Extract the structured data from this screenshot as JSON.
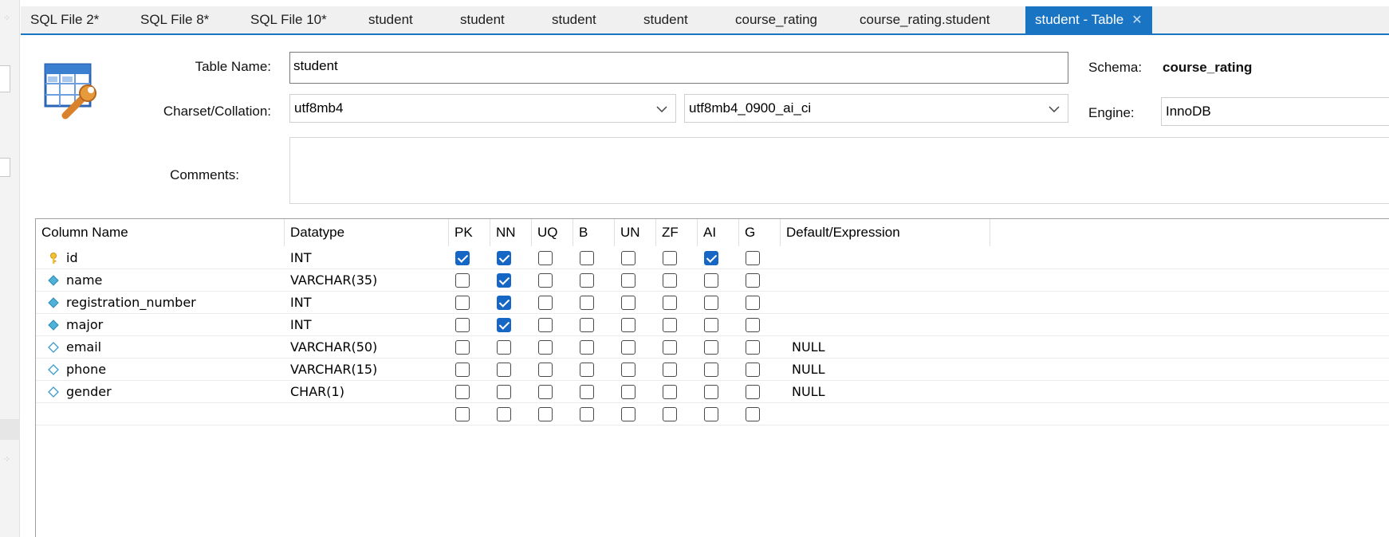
{
  "tabs": [
    {
      "label": "SQL File 2*"
    },
    {
      "label": "SQL File 8*"
    },
    {
      "label": "SQL File 10*"
    },
    {
      "label": "student"
    },
    {
      "label": "student"
    },
    {
      "label": "student"
    },
    {
      "label": "student"
    },
    {
      "label": "course_rating"
    },
    {
      "label": "course_rating.student"
    },
    {
      "label": "student - Table",
      "active": true
    }
  ],
  "form": {
    "table_name_label": "Table Name:",
    "table_name_value": "student",
    "schema_label": "Schema:",
    "schema_value": "course_rating",
    "charset_label": "Charset/Collation:",
    "charset_value": "utf8mb4",
    "collation_value": "utf8mb4_0900_ai_ci",
    "engine_label": "Engine:",
    "engine_value": "InnoDB",
    "comments_label": "Comments:",
    "comments_value": ""
  },
  "grid": {
    "headers": [
      "Column Name",
      "Datatype",
      "PK",
      "NN",
      "UQ",
      "B",
      "UN",
      "ZF",
      "AI",
      "G",
      "Default/Expression"
    ],
    "rows": [
      {
        "name": "id",
        "datatype": "INT",
        "icon": "primary-key-icon",
        "flags": [
          true,
          true,
          false,
          false,
          false,
          false,
          true,
          false
        ],
        "default": ""
      },
      {
        "name": "name",
        "datatype": "VARCHAR(35)",
        "icon": "not-null-column-icon",
        "flags": [
          false,
          true,
          false,
          false,
          false,
          false,
          false,
          false
        ],
        "default": ""
      },
      {
        "name": "registration_number",
        "datatype": "INT",
        "icon": "not-null-column-icon",
        "flags": [
          false,
          true,
          false,
          false,
          false,
          false,
          false,
          false
        ],
        "default": ""
      },
      {
        "name": "major",
        "datatype": "INT",
        "icon": "not-null-column-icon",
        "flags": [
          false,
          true,
          false,
          false,
          false,
          false,
          false,
          false
        ],
        "default": ""
      },
      {
        "name": "email",
        "datatype": "VARCHAR(50)",
        "icon": "nullable-column-icon",
        "flags": [
          false,
          false,
          false,
          false,
          false,
          false,
          false,
          false
        ],
        "default": "NULL"
      },
      {
        "name": "phone",
        "datatype": "VARCHAR(15)",
        "icon": "nullable-column-icon",
        "flags": [
          false,
          false,
          false,
          false,
          false,
          false,
          false,
          false
        ],
        "default": "NULL"
      },
      {
        "name": "gender",
        "datatype": "CHAR(1)",
        "icon": "nullable-column-icon",
        "flags": [
          false,
          false,
          false,
          false,
          false,
          false,
          false,
          false
        ],
        "default": "NULL"
      },
      {
        "name": "",
        "datatype": "",
        "icon": "",
        "flags": [
          false,
          false,
          false,
          false,
          false,
          false,
          false,
          false
        ],
        "default": ""
      }
    ]
  },
  "colors": {
    "accent": "#1a74c4",
    "checkbox_checked": "#1667c5",
    "key_icon": "#f2c230",
    "column_icon": "#4fb3d9"
  }
}
